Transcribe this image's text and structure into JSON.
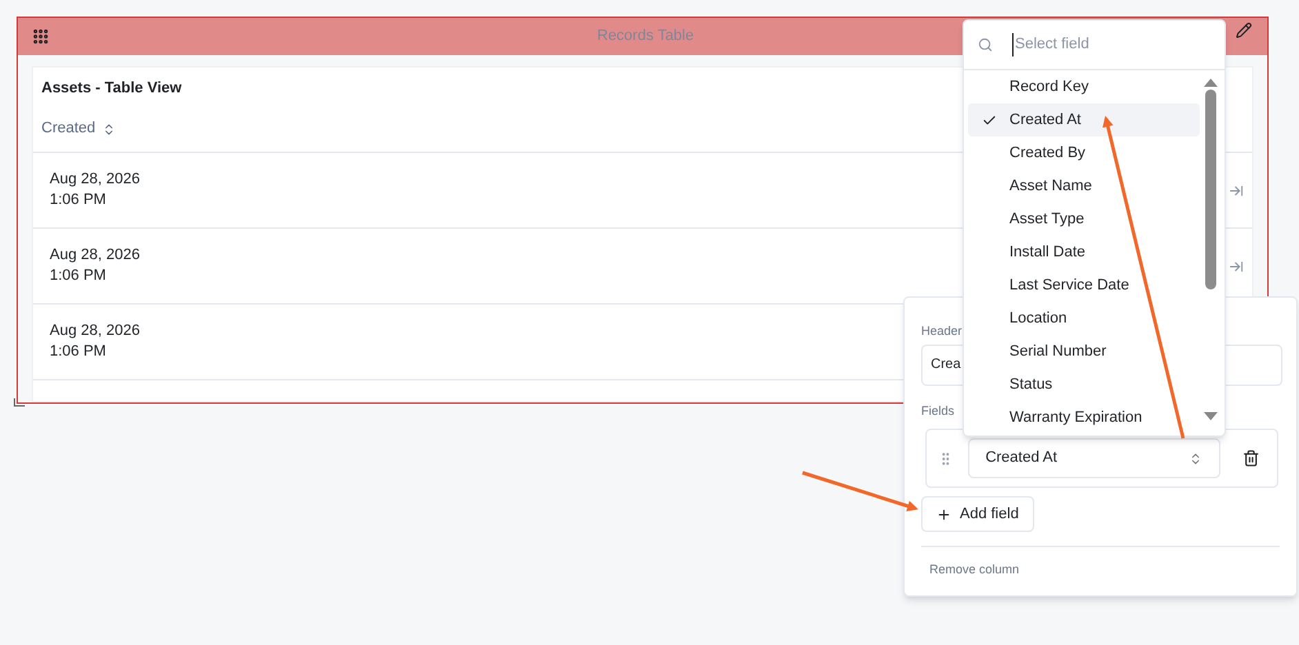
{
  "widget": {
    "title": "Records Table"
  },
  "table": {
    "title": "Assets - Table View",
    "columns": [
      {
        "label": "Created"
      }
    ],
    "rows": [
      {
        "date": "Aug 28, 2026",
        "time": "1:06 PM"
      },
      {
        "date": "Aug 28, 2026",
        "time": "1:06 PM"
      },
      {
        "date": "Aug 28, 2026",
        "time": "1:06 PM"
      }
    ]
  },
  "column_editor": {
    "header_label": "Header",
    "header_value": "Crea",
    "fields_label": "Fields",
    "fields": [
      {
        "value": "Created At"
      }
    ],
    "add_button": "Add field",
    "remove_link": "Remove column"
  },
  "field_picker": {
    "placeholder": "Select field",
    "options": [
      {
        "label": "Record Key",
        "selected": false
      },
      {
        "label": "Created At",
        "selected": true
      },
      {
        "label": "Created By",
        "selected": false
      },
      {
        "label": "Asset Name",
        "selected": false
      },
      {
        "label": "Asset Type",
        "selected": false
      },
      {
        "label": "Install Date",
        "selected": false
      },
      {
        "label": "Last Service Date",
        "selected": false
      },
      {
        "label": "Location",
        "selected": false
      },
      {
        "label": "Serial Number",
        "selected": false
      },
      {
        "label": "Status",
        "selected": false
      },
      {
        "label": "Warranty Expiration",
        "selected": false
      }
    ]
  }
}
